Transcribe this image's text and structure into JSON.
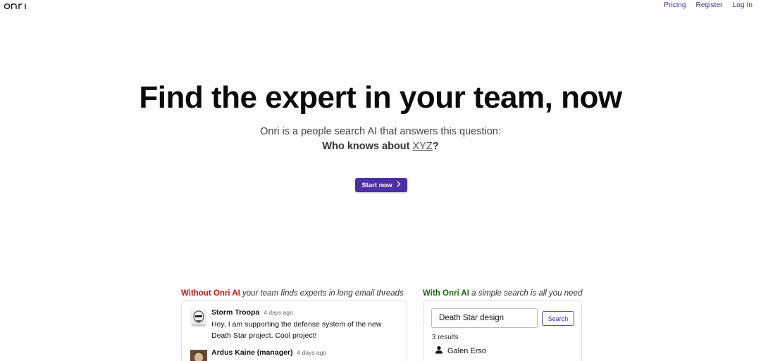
{
  "brand": {
    "logo_text": "onri"
  },
  "nav": {
    "pricing": "Pricing",
    "register": "Register",
    "login": "Log In"
  },
  "hero": {
    "title": "Find the expert in your team, now",
    "subtitle": "Onri is a people search AI that answers this question:",
    "question_prefix": "Who knows about ",
    "question_topic": "XYZ",
    "question_suffix": "?",
    "cta_label": "Start now"
  },
  "without": {
    "caption_strong": "Without Onri AI",
    "caption_rest": " your team finds experts in long email threads",
    "messages": [
      {
        "name": "Storm Troopa",
        "time": "4 days ago",
        "text": "Hey, I am supporting the defense system of the new Death Star project. Cool project!"
      },
      {
        "name": "Ardus Kaine (manager)",
        "time": "4 days ago",
        "text": ""
      }
    ]
  },
  "with": {
    "caption_strong": "With Onri AI",
    "caption_rest": " a simple search is all you need",
    "search_value": "Death Star design",
    "search_button": "Search",
    "results_count": "3 results",
    "results": [
      {
        "name": "Galen Erso",
        "icon": "person-icon"
      }
    ]
  },
  "colors": {
    "accent": "#4a2fa6",
    "nav_link": "#3b2a9e",
    "without": "#d01818",
    "with": "#1d6a14"
  }
}
